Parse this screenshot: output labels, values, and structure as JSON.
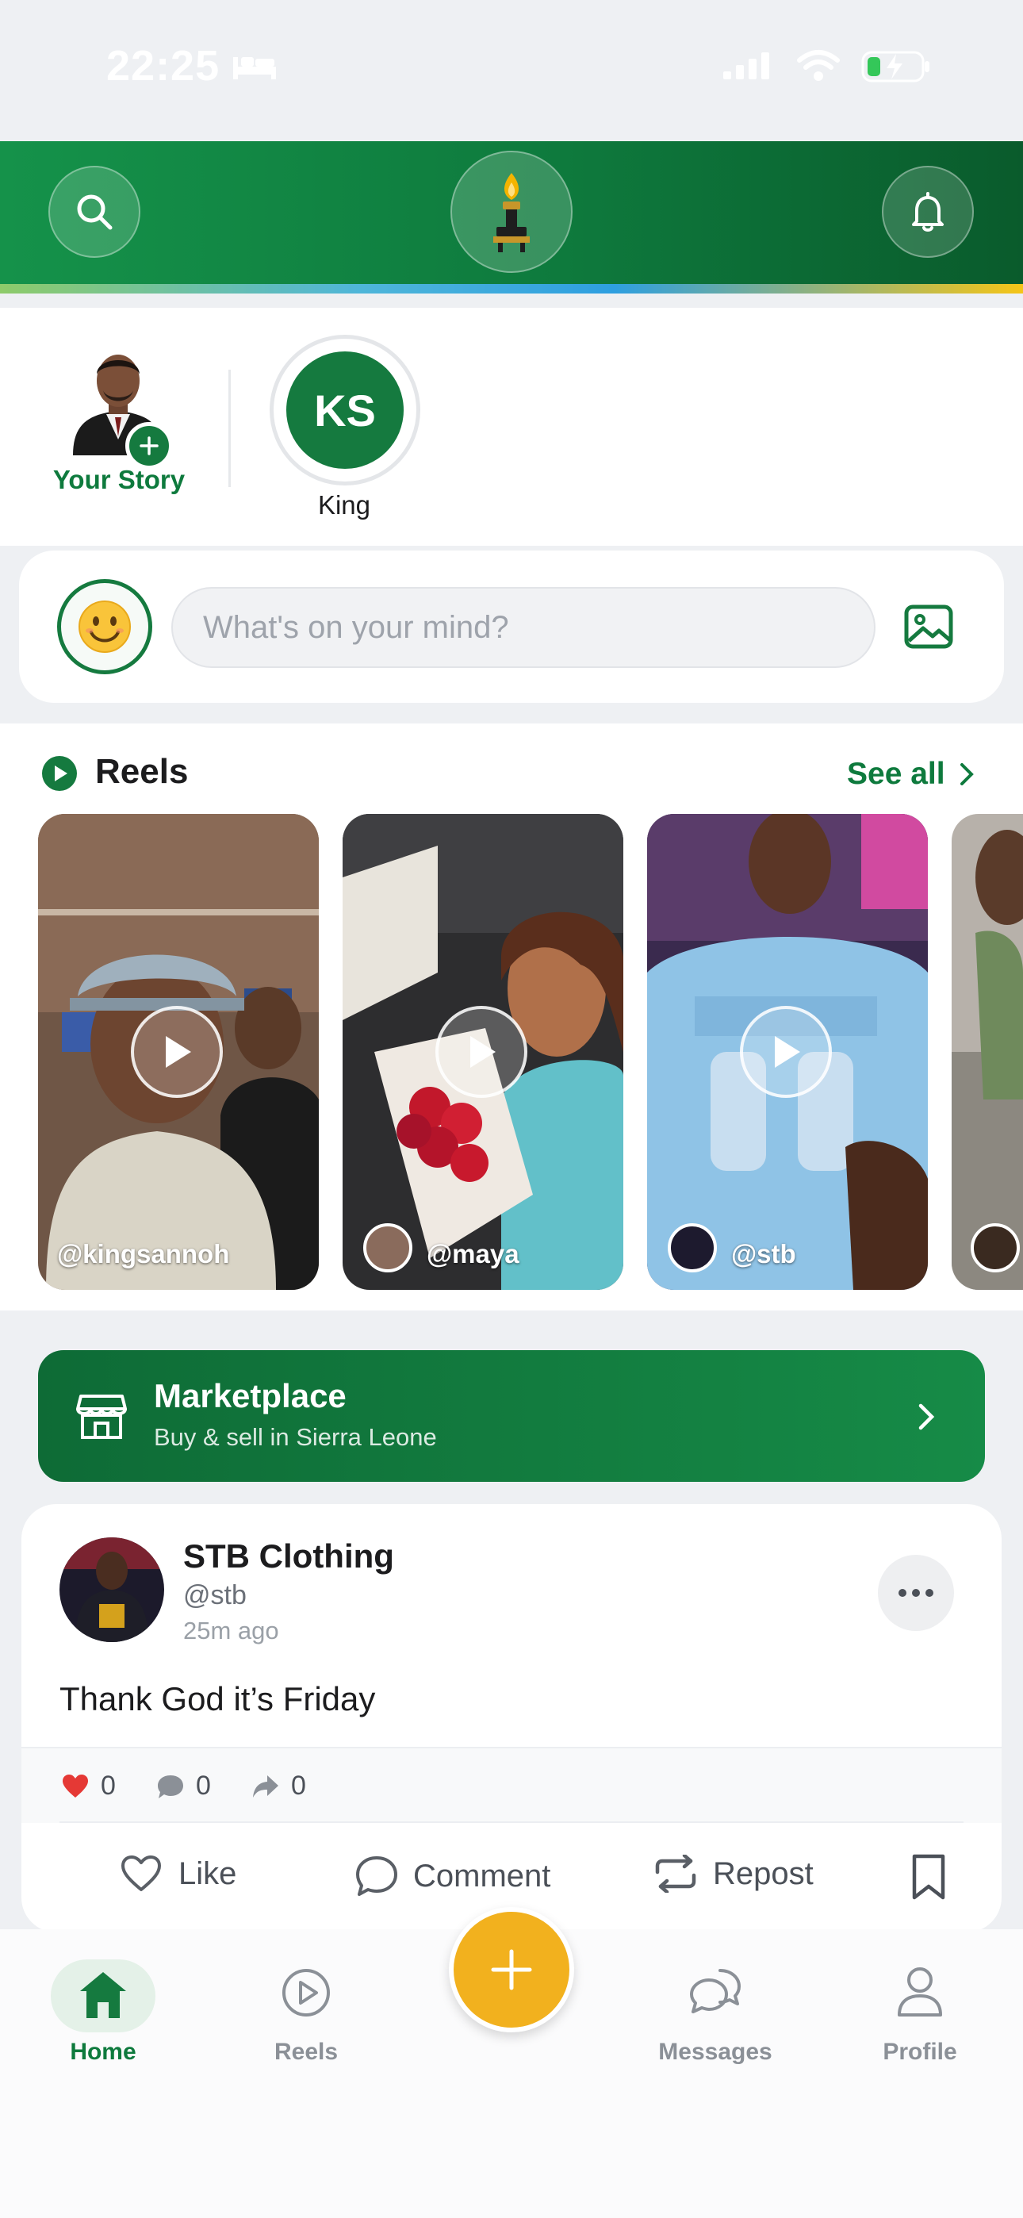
{
  "status_bar": {
    "time": "22:25"
  },
  "header": {
    "search_icon": "search-icon",
    "logo_icon": "torch-logo",
    "notification_icon": "bell-icon"
  },
  "stories": [
    {
      "label": "Your Story"
    },
    {
      "initials": "KS",
      "label": "King"
    }
  ],
  "composer": {
    "placeholder": "What's on your mind?"
  },
  "reels": {
    "title": "Reels",
    "see_all": "See all",
    "items": [
      {
        "handle": "@kingsannoh"
      },
      {
        "handle": "@maya"
      },
      {
        "handle": "@stb"
      }
    ]
  },
  "marketplace": {
    "title": "Marketplace",
    "subtitle": "Buy & sell in Sierra Leone"
  },
  "post": {
    "author": "STB Clothing",
    "handle": "@stb",
    "time": "25m ago",
    "body": "Thank God it’s Friday",
    "stats": {
      "likes": "0",
      "comments": "0",
      "shares": "0"
    },
    "actions": {
      "like": "Like",
      "comment": "Comment",
      "repost": "Repost"
    }
  },
  "bottom_nav": {
    "home": "Home",
    "reels": "Reels",
    "messages": "Messages",
    "profile": "Profile"
  },
  "colors": {
    "brand_green": "#0e7a3d",
    "accent_yellow": "#f2b11e",
    "like_red": "#e53935"
  }
}
